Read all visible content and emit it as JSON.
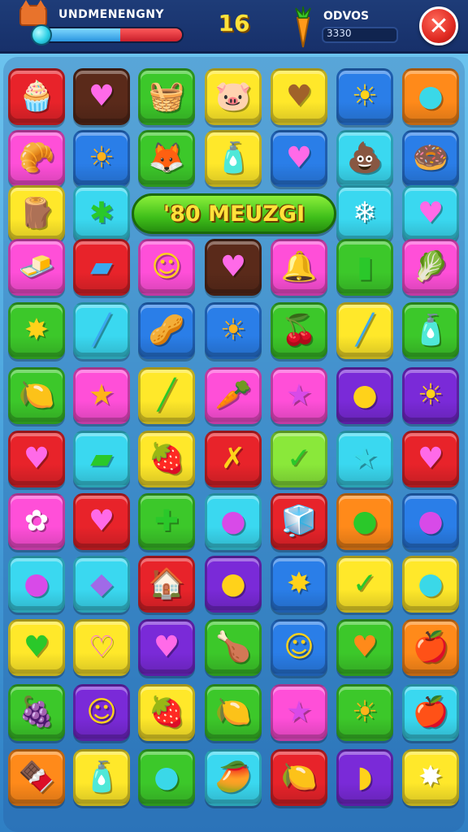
{
  "hud": {
    "player_name": "UNDMENENGNY",
    "player_icon": "fox-head-icon",
    "health_fraction": 0.55,
    "score": "16",
    "resource_icon": "carrot-icon",
    "resource_label": "ODVOS",
    "resource_value": "3330",
    "close_label": "✕"
  },
  "banner": {
    "text": "'80 MEUZGI"
  },
  "colors": {
    "red": "#e8232a",
    "brown": "#5a2a1a",
    "green": "#3cc82a",
    "yellow": "#ffe82a",
    "blue": "#2a7ee8",
    "cyan": "#3ad8f0",
    "pink": "#ff4fd8",
    "purple": "#7a2ad8",
    "orange": "#ff8a1a",
    "lime": "#8ae83a"
  },
  "tiles": [
    [
      {
        "color": "red",
        "glyph": "🧁",
        "icon": "cupcake-icon"
      },
      {
        "color": "brown",
        "glyph": "♥",
        "icon": "heart-icon",
        "fg": "#ff6ae8"
      },
      {
        "color": "green",
        "glyph": "🧺",
        "icon": "basket-icon"
      },
      {
        "color": "yellow",
        "glyph": "🐷",
        "icon": "pig-face-icon"
      },
      {
        "color": "yellow",
        "glyph": "♥",
        "icon": "heart-icon",
        "fg": "#a0622a"
      },
      {
        "color": "blue",
        "glyph": "☀",
        "icon": "sun-icon",
        "fg": "#ffd21a"
      },
      {
        "color": "orange",
        "glyph": "●",
        "icon": "orb-icon",
        "fg": "#3ad8e8"
      }
    ],
    [
      {
        "color": "pink",
        "glyph": "🥐",
        "icon": "croissant-icon"
      },
      {
        "color": "blue",
        "glyph": "☀",
        "icon": "sun-icon",
        "fg": "#ffb21a"
      },
      {
        "color": "green",
        "glyph": "🦊",
        "icon": "fox-icon"
      },
      {
        "color": "yellow",
        "glyph": "🧴",
        "icon": "bottle-icon"
      },
      {
        "color": "blue",
        "glyph": "♥",
        "icon": "heart-icon",
        "fg": "#ff6ae8"
      },
      {
        "color": "cyan",
        "glyph": "💩",
        "icon": "mound-icon"
      },
      {
        "color": "blue",
        "glyph": "🍩",
        "icon": "donut-icon"
      }
    ],
    [
      {
        "color": "yellow",
        "glyph": "🪵",
        "icon": "log-icon"
      },
      {
        "color": "cyan",
        "glyph": "✱",
        "icon": "leaf-star-icon",
        "fg": "#2ac82a"
      },
      null,
      null,
      null,
      {
        "color": "cyan",
        "glyph": "❄",
        "icon": "snowflake-icon",
        "fg": "#ffffff"
      },
      {
        "color": "cyan",
        "glyph": "♥",
        "icon": "heart-icon",
        "fg": "#ff6ae8"
      }
    ],
    [
      {
        "color": "pink",
        "glyph": "🧈",
        "icon": "butter-icon"
      },
      {
        "color": "red",
        "glyph": "▰",
        "icon": "bar-icon",
        "fg": "#3aa8f0"
      },
      {
        "color": "pink",
        "glyph": "☺",
        "icon": "smiley-icon",
        "fg": "#ffd21a"
      },
      {
        "color": "brown",
        "glyph": "♥",
        "icon": "heart-icon",
        "fg": "#ff6ae8"
      },
      {
        "color": "pink",
        "glyph": "🔔",
        "icon": "bell-icon"
      },
      {
        "color": "green",
        "glyph": "▮",
        "icon": "block-icon",
        "fg": "#2ac82a"
      },
      {
        "color": "pink",
        "glyph": "🥬",
        "icon": "lettuce-icon"
      }
    ],
    [
      {
        "color": "green",
        "glyph": "✸",
        "icon": "star-burst-icon",
        "fg": "#ffd21a"
      },
      {
        "color": "cyan",
        "glyph": "╱",
        "icon": "stick-icon",
        "fg": "#3aa8f0"
      },
      {
        "color": "blue",
        "glyph": "🥜",
        "icon": "peanut-icon"
      },
      {
        "color": "blue",
        "glyph": "☀",
        "icon": "sun-icon",
        "fg": "#ffb21a"
      },
      {
        "color": "green",
        "glyph": "🍒",
        "icon": "berry-icon"
      },
      {
        "color": "yellow",
        "glyph": "╱",
        "icon": "stick-icon",
        "fg": "#3aa8f0"
      },
      {
        "color": "green",
        "glyph": "🧴",
        "icon": "bottle-icon"
      }
    ],
    [
      {
        "color": "green",
        "glyph": "🍋",
        "icon": "lemon-icon"
      },
      {
        "color": "pink",
        "glyph": "★",
        "icon": "star-icon",
        "fg": "#ffb21a"
      },
      {
        "color": "yellow",
        "glyph": "╱",
        "icon": "stick-icon",
        "fg": "#2ac82a"
      },
      {
        "color": "pink",
        "glyph": "🥕",
        "icon": "carrot-icon"
      },
      {
        "color": "pink",
        "glyph": "★",
        "icon": "star-icon",
        "fg": "#d84ae8"
      },
      {
        "color": "purple",
        "glyph": "●",
        "icon": "orb-icon",
        "fg": "#ffd21a"
      },
      {
        "color": "purple",
        "glyph": "☀",
        "icon": "sun-face-icon",
        "fg": "#ffd21a"
      }
    ],
    [
      {
        "color": "red",
        "glyph": "♥",
        "icon": "heart-icon",
        "fg": "#ff6ae8"
      },
      {
        "color": "cyan",
        "glyph": "▰",
        "icon": "bar-icon",
        "fg": "#2ac82a"
      },
      {
        "color": "yellow",
        "glyph": "🍓",
        "icon": "strawberry-icon"
      },
      {
        "color": "red",
        "glyph": "✗",
        "icon": "cross-icon",
        "fg": "#ffd21a"
      },
      {
        "color": "lime",
        "glyph": "✓",
        "icon": "check-icon",
        "fg": "#2ac82a"
      },
      {
        "color": "cyan",
        "glyph": "★",
        "icon": "star-icon",
        "fg": "#3ad8e8"
      },
      {
        "color": "red",
        "glyph": "♥",
        "icon": "heart-icon",
        "fg": "#ff6ae8"
      }
    ],
    [
      {
        "color": "pink",
        "glyph": "✿",
        "icon": "flower-icon",
        "fg": "#ffffff"
      },
      {
        "color": "red",
        "glyph": "♥",
        "icon": "heart-icon",
        "fg": "#ff6ae8"
      },
      {
        "color": "green",
        "glyph": "✚",
        "icon": "cross-plus-icon",
        "fg": "#2ac82a"
      },
      {
        "color": "cyan",
        "glyph": "●",
        "icon": "plum-icon",
        "fg": "#d84ae8"
      },
      {
        "color": "red",
        "glyph": "🧊",
        "icon": "sugar-cube-icon"
      },
      {
        "color": "orange",
        "glyph": "●",
        "icon": "orb-icon",
        "fg": "#2ac82a"
      },
      {
        "color": "blue",
        "glyph": "●",
        "icon": "plum-icon",
        "fg": "#d84ae8"
      }
    ],
    [
      {
        "color": "cyan",
        "glyph": "●",
        "icon": "plum-icon",
        "fg": "#d84ae8"
      },
      {
        "color": "cyan",
        "glyph": "◆",
        "icon": "gem-icon",
        "fg": "#a06ae8"
      },
      {
        "color": "red",
        "glyph": "🏠",
        "icon": "shop-icon"
      },
      {
        "color": "purple",
        "glyph": "●",
        "icon": "coin-icon",
        "fg": "#ffd21a"
      },
      {
        "color": "blue",
        "glyph": "✸",
        "icon": "star-burst-icon",
        "fg": "#ffd21a"
      },
      {
        "color": "yellow",
        "glyph": "✓",
        "icon": "check-icon",
        "fg": "#2ac82a"
      },
      {
        "color": "yellow",
        "glyph": "●",
        "icon": "orb-icon",
        "fg": "#3ad8e8"
      }
    ],
    [
      {
        "color": "yellow",
        "glyph": "♥",
        "icon": "heart-icon",
        "fg": "#2ac82a"
      },
      {
        "color": "yellow",
        "glyph": "♡",
        "icon": "heart-outline-icon",
        "fg": "#ff6ae8"
      },
      {
        "color": "purple",
        "glyph": "♥",
        "icon": "heart-icon",
        "fg": "#ff6ae8"
      },
      {
        "color": "green",
        "glyph": "🍗",
        "icon": "drumstick-icon"
      },
      {
        "color": "blue",
        "glyph": "☺",
        "icon": "smiley-icon",
        "fg": "#ffd21a"
      },
      {
        "color": "green",
        "glyph": "♥",
        "icon": "heart-icon",
        "fg": "#ff8a1a"
      },
      {
        "color": "orange",
        "glyph": "🍎",
        "icon": "apple-icon"
      }
    ],
    [
      {
        "color": "green",
        "glyph": "🍇",
        "icon": "grape-icon"
      },
      {
        "color": "purple",
        "glyph": "☺",
        "icon": "face-icon",
        "fg": "#ffd21a"
      },
      {
        "color": "yellow",
        "glyph": "🍓",
        "icon": "strawberry-icon"
      },
      {
        "color": "green",
        "glyph": "🍋",
        "icon": "lemon-icon"
      },
      {
        "color": "pink",
        "glyph": "★",
        "icon": "star-icon",
        "fg": "#d84ae8"
      },
      {
        "color": "green",
        "glyph": "☀",
        "icon": "sun-icon",
        "fg": "#ffb21a"
      },
      {
        "color": "cyan",
        "glyph": "🍎",
        "icon": "apple-icon"
      }
    ],
    [
      {
        "color": "orange",
        "glyph": "🍫",
        "icon": "candy-bar-icon"
      },
      {
        "color": "yellow",
        "glyph": "🧴",
        "icon": "bottle-icon"
      },
      {
        "color": "green",
        "glyph": "●",
        "icon": "orb-icon",
        "fg": "#3ad8e8"
      },
      {
        "color": "cyan",
        "glyph": "🥭",
        "icon": "mango-icon"
      },
      {
        "color": "red",
        "glyph": "🍋",
        "icon": "lemon-icon"
      },
      {
        "color": "purple",
        "glyph": "◗",
        "icon": "pouch-icon",
        "fg": "#ffd21a"
      },
      {
        "color": "yellow",
        "glyph": "✸",
        "icon": "star-burst-icon",
        "fg": "#ffffff"
      }
    ]
  ]
}
